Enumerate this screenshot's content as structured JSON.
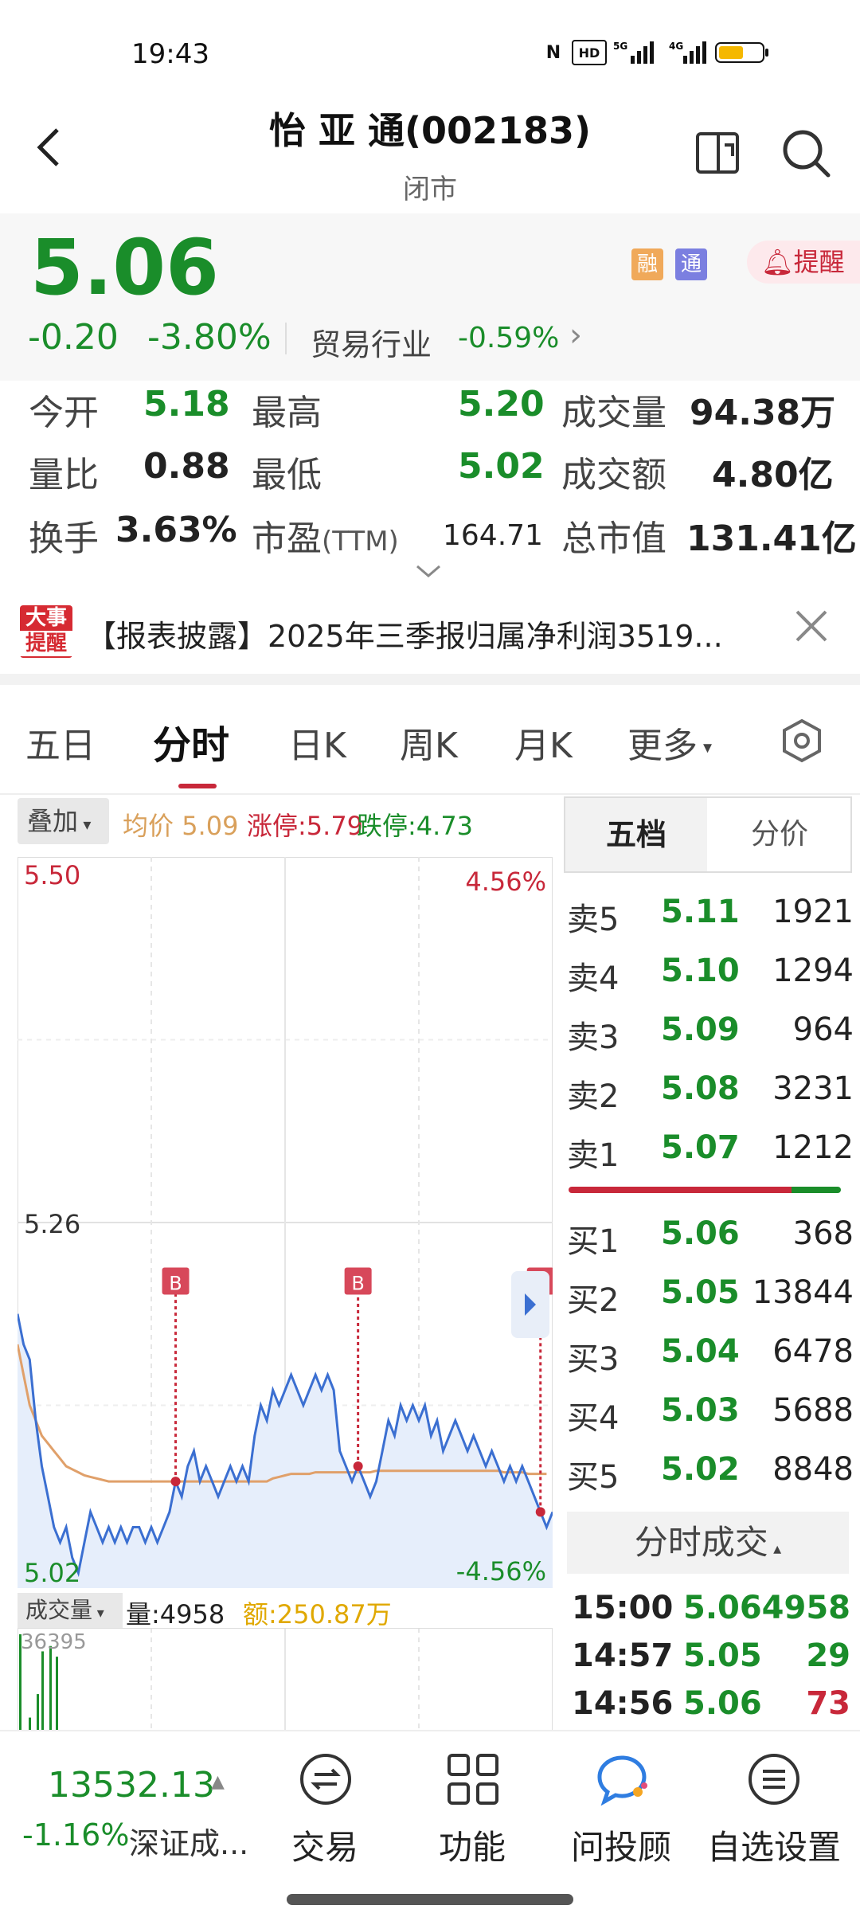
{
  "status_bar": {
    "time": "19:43",
    "battery_color": "#f5b800"
  },
  "header": {
    "title": "怡 亚 通(002183)",
    "subtitle": "闭市"
  },
  "quote": {
    "price": "5.06",
    "change": "-0.20",
    "change_pct": "-3.80%",
    "industry": "贸易行业",
    "industry_pct": "-0.59%",
    "badge_margin": "融",
    "badge_connect": "通",
    "alert_label": "提醒"
  },
  "stats": {
    "open_label": "今开",
    "open": "5.18",
    "high_label": "最高",
    "high": "5.20",
    "volume_label": "成交量",
    "volume": "94.38万",
    "ratio_label": "量比",
    "ratio": "0.88",
    "low_label": "最低",
    "low": "5.02",
    "amount_label": "成交额",
    "amount": "4.80亿",
    "turnover_label": "换手",
    "turnover": "3.63%",
    "pe_label": "市盈",
    "pe_suffix": "(TTM)",
    "pe": "164.71",
    "mcap_label": "总市值",
    "mcap": "131.41亿"
  },
  "news": {
    "badge_line1": "大事",
    "badge_line2": "提醒",
    "text": "【报表披露】2025年三季报归属净利润3519..."
  },
  "tabs": [
    "五日",
    "分时",
    "日K",
    "周K",
    "月K",
    "更多"
  ],
  "chart_header": {
    "overlay": "叠加",
    "avg_label": "均价",
    "avg": "5.09",
    "limit_up": "涨停:5.79",
    "limit_down": "跌停:4.73"
  },
  "chart_labels": {
    "y_top": "5.50",
    "y_mid": "5.26",
    "y_bottom": "5.02",
    "pct_top": "4.56%",
    "pct_bottom": "-4.56%",
    "marker": "B"
  },
  "chart_data": {
    "type": "line",
    "ylim": [
      5.02,
      5.5
    ],
    "series": [
      {
        "values": [
          5.2,
          5.18,
          5.17,
          5.13,
          5.1,
          5.08,
          5.06,
          5.05,
          5.06,
          5.04,
          5.03,
          5.05,
          5.07,
          5.06,
          5.05,
          5.06,
          5.05,
          5.06,
          5.05,
          5.06,
          5.06,
          5.05,
          5.06,
          5.05,
          5.06,
          5.07,
          5.09,
          5.08,
          5.1,
          5.11,
          5.09,
          5.1,
          5.09,
          5.08,
          5.09,
          5.1,
          5.09,
          5.1,
          5.09,
          5.12,
          5.14,
          5.13,
          5.15,
          5.14,
          5.15,
          5.16,
          5.15,
          5.14,
          5.15,
          5.16,
          5.15,
          5.16,
          5.15,
          5.11,
          5.1,
          5.09,
          5.1,
          5.09,
          5.08,
          5.09,
          5.11,
          5.13,
          5.12,
          5.14,
          5.13,
          5.14,
          5.13,
          5.14,
          5.12,
          5.13,
          5.11,
          5.12,
          5.13,
          5.12,
          5.11,
          5.12,
          5.11,
          5.1,
          5.11,
          5.1,
          5.09,
          5.1,
          5.09,
          5.1,
          5.09,
          5.08,
          5.07,
          5.06,
          5.07
        ]
      },
      {
        "values": [
          5.18,
          5.16,
          5.14,
          5.13,
          5.12,
          5.115,
          5.11,
          5.105,
          5.1,
          5.098,
          5.096,
          5.094,
          5.093,
          5.092,
          5.091,
          5.09,
          5.09,
          5.09,
          5.09,
          5.09,
          5.09,
          5.09,
          5.09,
          5.09,
          5.09,
          5.09,
          5.09,
          5.09,
          5.09,
          5.09,
          5.09,
          5.09,
          5.09,
          5.09,
          5.09,
          5.09,
          5.09,
          5.09,
          5.09,
          5.09,
          5.09,
          5.09,
          5.092,
          5.093,
          5.094,
          5.095,
          5.095,
          5.095,
          5.095,
          5.096,
          5.096,
          5.096,
          5.096,
          5.096,
          5.096,
          5.096,
          5.096,
          5.096,
          5.096,
          5.097,
          5.097,
          5.097,
          5.097,
          5.097,
          5.097,
          5.097,
          5.097,
          5.097,
          5.097,
          5.097,
          5.097,
          5.097,
          5.097,
          5.097,
          5.097,
          5.097,
          5.097,
          5.097,
          5.097,
          5.097,
          5.096,
          5.096,
          5.096,
          5.096,
          5.095,
          5.095,
          5.095,
          5.095
        ]
      }
    ],
    "volume_max": "36395",
    "volume": [
      36395,
      5200,
      14000,
      30000,
      32000,
      28000
    ]
  },
  "volume_header": {
    "button": "成交量",
    "vol": "量:4958",
    "amt": "额:250.87万"
  },
  "order_book": {
    "tab_five": "五档",
    "tab_price": "分价",
    "asks": [
      {
        "label": "卖5",
        "price": "5.11",
        "qty": "1921"
      },
      {
        "label": "卖4",
        "price": "5.10",
        "qty": "1294"
      },
      {
        "label": "卖3",
        "price": "5.09",
        "qty": "964"
      },
      {
        "label": "卖2",
        "price": "5.08",
        "qty": "3231"
      },
      {
        "label": "卖1",
        "price": "5.07",
        "qty": "1212"
      }
    ],
    "bids": [
      {
        "label": "买1",
        "price": "5.06",
        "qty": "368"
      },
      {
        "label": "买2",
        "price": "5.05",
        "qty": "13844"
      },
      {
        "label": "买3",
        "price": "5.04",
        "qty": "6478"
      },
      {
        "label": "买4",
        "price": "5.03",
        "qty": "5688"
      },
      {
        "label": "买5",
        "price": "5.02",
        "qty": "8848"
      }
    ]
  },
  "ticks": {
    "header": "分时成交",
    "rows": [
      {
        "time": "15:00",
        "price": "5.06",
        "vol": "4958",
        "color": "#1a8d2a"
      },
      {
        "time": "14:57",
        "price": "5.05",
        "vol": "29",
        "color": "#1a8d2a"
      },
      {
        "time": "14:56",
        "price": "5.06",
        "vol": "73",
        "color": "#c8283a"
      }
    ]
  },
  "bottom_nav": {
    "index_value": "13532.13",
    "index_change": "-1.16%",
    "index_name": "深证成...",
    "items": [
      "交易",
      "功能",
      "问投顾",
      "自选设置"
    ]
  }
}
